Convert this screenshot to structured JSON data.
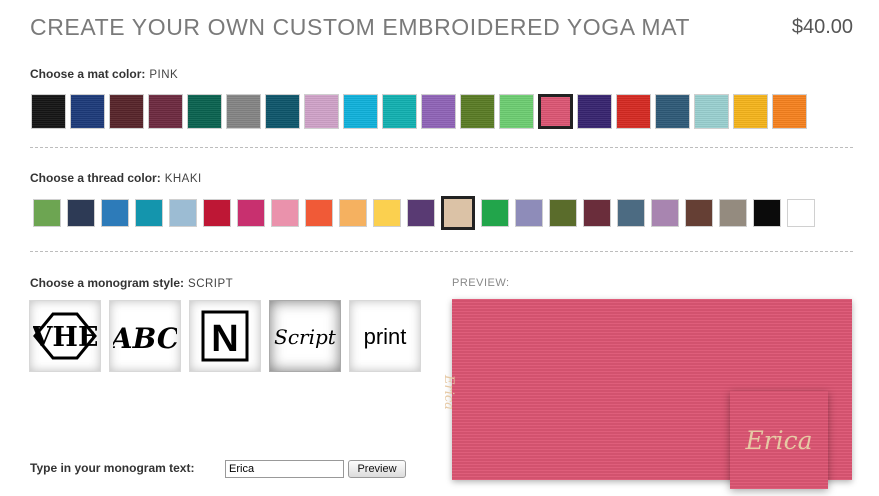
{
  "page_title": "CREATE YOUR OWN CUSTOM EMBROIDERED YOGA MAT",
  "price": "$40.00",
  "mat_color": {
    "label": "Choose a mat color:",
    "value": "PINK",
    "swatches": [
      "#151515",
      "#1d3a7a",
      "#57242a",
      "#6d2a40",
      "#0a6350",
      "#858585",
      "#0e566b",
      "#d0a3c9",
      "#10b2dc",
      "#12b1b1",
      "#9064b8",
      "#5a7c25",
      "#6dce72",
      "#dd5674",
      "#372470",
      "#d62a22",
      "#2f5a78",
      "#9ad0d0",
      "#f5b51c",
      "#f7821f"
    ],
    "selected_index": 13
  },
  "thread_color": {
    "label": "Choose a thread color:",
    "value": "KHAKI",
    "swatches": [
      "#6da552",
      "#2d3a55",
      "#2d7bb9",
      "#1495ad",
      "#9cbcd3",
      "#be1735",
      "#c8306f",
      "#ea92ac",
      "#f05a37",
      "#f5b160",
      "#fbd04f",
      "#593a73",
      "#dbc2a6",
      "#22a54b",
      "#8e8cb9",
      "#5a6c2b",
      "#6a2d3b",
      "#4c6b82",
      "#a885b0",
      "#653f34",
      "#948b7f",
      "#0b0b0b",
      "#ffffff"
    ],
    "selected_index": 12
  },
  "monogram_style": {
    "label": "Choose a monogram style:",
    "value": "SCRIPT",
    "options": [
      {
        "name": "diamond",
        "text": "VHE"
      },
      {
        "name": "circle-script",
        "text": "ABC"
      },
      {
        "name": "block",
        "text": "N"
      },
      {
        "name": "script",
        "text": "Script"
      },
      {
        "name": "print",
        "text": "print"
      }
    ],
    "selected_index": 3
  },
  "preview": {
    "label": "PREVIEW:",
    "mat_color": "#dd5674",
    "thread_color": "#e6c9a4",
    "text": "Erica"
  },
  "monogram_text": {
    "label": "Type in your monogram text:",
    "value": "Erica",
    "button_label": "Preview"
  }
}
